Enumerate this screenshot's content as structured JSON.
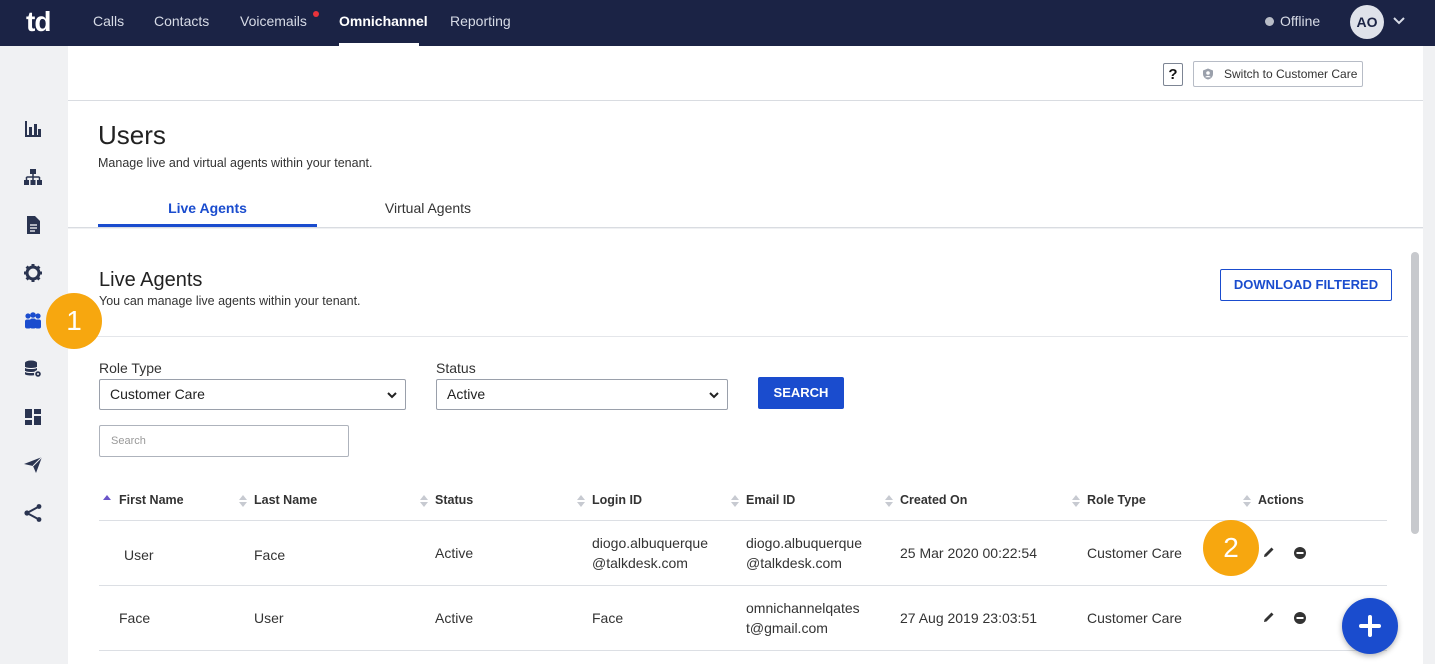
{
  "topnav": {
    "logo": "td",
    "items": [
      "Calls",
      "Contacts",
      "Voicemails",
      "Omnichannel",
      "Reporting"
    ],
    "active": "Omnichannel",
    "status": "Offline",
    "avatar_initials": "AO"
  },
  "sidebar": {
    "icons": [
      "dashboard-icon",
      "org-chart-icon",
      "document-icon",
      "settings-icon",
      "users-icon",
      "database-settings-icon",
      "layout-icon",
      "send-icon",
      "share-icon"
    ],
    "active": "users-icon"
  },
  "header": {
    "help_label": "?",
    "switch_label": "Switch to Customer Care",
    "title": "Users",
    "subtitle": "Manage live and virtual agents within your tenant.",
    "tabs": [
      {
        "label": "Live Agents",
        "active": true
      },
      {
        "label": "Virtual Agents",
        "active": false
      }
    ]
  },
  "section": {
    "title": "Live Agents",
    "subtitle": "You can manage live agents within your tenant.",
    "download_label": "DOWNLOAD FILTERED"
  },
  "filters": {
    "role_label": "Role Type",
    "role_value": "Customer Care",
    "status_label": "Status",
    "status_value": "Active",
    "search_button": "SEARCH",
    "search_placeholder": "Search"
  },
  "table": {
    "columns": [
      "First Name",
      "Last Name",
      "Status",
      "Login ID",
      "Email ID",
      "Created On",
      "Role Type",
      "Actions"
    ],
    "sorted_column": "First Name",
    "rows": [
      {
        "first_name": "User",
        "last_name": "Face",
        "status": "Active",
        "login_id": [
          "diogo.albuquerque",
          "@talkdesk.com"
        ],
        "email_id": [
          "diogo.albuquerque",
          "@talkdesk.com"
        ],
        "created_on": "25 Mar 2020 00:22:54",
        "role_type": "Customer Care"
      },
      {
        "first_name": "Face",
        "last_name": "User",
        "status": "Active",
        "login_id": [
          "Face",
          ""
        ],
        "email_id": [
          "omnichannelqates",
          "t@gmail.com"
        ],
        "created_on": "27 Aug 2019 23:03:51",
        "role_type": "Customer Care"
      }
    ]
  },
  "badges": [
    "1",
    "2"
  ],
  "colors": {
    "nav_bg": "#1b2345",
    "accent": "#1a4cce",
    "badge": "#f7a70f"
  }
}
